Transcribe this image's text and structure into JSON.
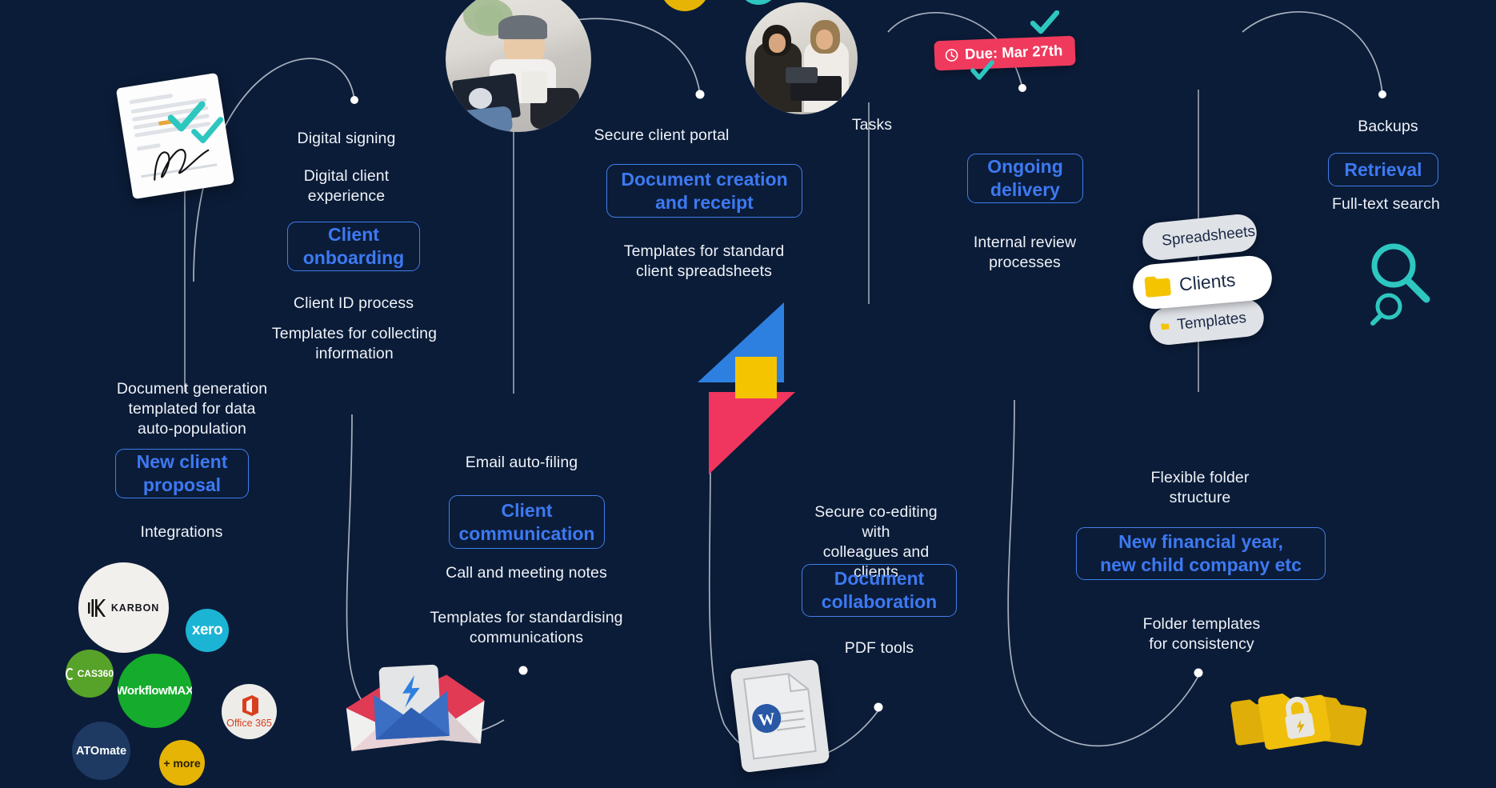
{
  "theme": {
    "background": "#0b1c38",
    "accent_blue": "#3d79f2",
    "accent_teal": "#2ec7c0",
    "accent_pink": "#ef3a5d",
    "accent_yellow": "#f5c400",
    "text_light": "#eef2f8"
  },
  "branches": {
    "client_onboarding": {
      "above_1": "Digital signing",
      "above_2": "Digital client\nexperience",
      "pill": "Client\nonboarding",
      "below_1": "Client ID process",
      "below_2": "Templates for collecting\ninformation"
    },
    "new_client_proposal": {
      "above_1": "Document generation\ntemplated for data\nauto-population",
      "pill": "New client\nproposal",
      "below_1": "Integrations"
    },
    "document_creation": {
      "above_1": "Secure client portal",
      "pill": "Document creation\nand receipt",
      "below_1": "Templates for standard\nclient spreadsheets"
    },
    "client_communication": {
      "above_1": "Email auto-filing",
      "pill": "Client\ncommunication",
      "below_1": "Call and meeting notes",
      "below_2": "Templates for standardising\ncommunications"
    },
    "ongoing_delivery": {
      "above_1": "Tasks",
      "pill": "Ongoing\ndelivery",
      "below_1": "Internal review\nprocesses",
      "badge": {
        "label": "Due: Mar 27th",
        "icon": "clock-icon",
        "color": "#ef3a5d"
      }
    },
    "document_collaboration": {
      "above_1": "Secure co-editing with\ncolleagues and clients",
      "pill": "Document\ncollaboration",
      "below_1": "PDF tools"
    },
    "retrieval": {
      "above_1": "Backups",
      "pill": "Retrieval",
      "below_1": "Full-text search"
    },
    "new_financial_year": {
      "above_1": "Flexible folder\nstructure",
      "pill": "New financial year,\nnew child company etc",
      "below_1": "Folder templates\nfor consistency"
    }
  },
  "folder_pills": [
    {
      "label": "Spreadsheets",
      "style": "back"
    },
    {
      "label": "Clients",
      "style": "front"
    },
    {
      "label": "Templates",
      "style": "back"
    }
  ],
  "integrations": [
    {
      "name": "Karbon",
      "label": "KARBON",
      "color": "#f2f0ec"
    },
    {
      "name": "Xero",
      "label": "xero",
      "color": "#1bb4d4"
    },
    {
      "name": "CAS 360",
      "label": "CAS360",
      "color": "#57a229"
    },
    {
      "name": "WorkflowMax",
      "label": "WorkflowMAX",
      "color": "#15ab2c"
    },
    {
      "name": "ATOmate",
      "label": "ATOmate",
      "color": "#1e3a63"
    },
    {
      "name": "Office 365",
      "label": "Office 365",
      "color": "#eeece9"
    },
    {
      "name": "More",
      "label": "+ more",
      "color": "#e5b405"
    }
  ],
  "icons": {
    "signed_document": "signed-document-icon",
    "center_logo": "fyi-lightning-logo",
    "envelopes": "envelope-stack-icon",
    "word_document": "word-document-icon",
    "locked_folders": "locked-folders-icon",
    "magnifier_large": "search-icon",
    "magnifier_small": "search-icon-small",
    "photo_left": "person-with-laptop-photo",
    "photo_right": "two-people-with-laptop-photo"
  }
}
